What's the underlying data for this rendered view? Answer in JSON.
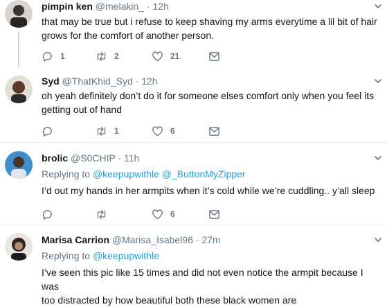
{
  "tweets": [
    {
      "name": "pimpin ken",
      "handle": "@melakin_",
      "dot": "·",
      "time": "12h",
      "lines": [
        "that may be true but i refuse to keep shaving my arms everytime a lil bit of hair",
        "grows for the comfort of another person."
      ],
      "replies": "1",
      "retweets": "2",
      "likes": "21"
    },
    {
      "name": "Syd",
      "handle": "@ThatKhid_Syd",
      "dot": "·",
      "time": "12h",
      "lines": [
        "oh yeah definitely don’t do it for someone elses comfort only when you feel its",
        "getting out of hand"
      ],
      "replies": "",
      "retweets": "1",
      "likes": "6"
    },
    {
      "name": "brolic",
      "handle": "@S0CHIP",
      "dot": "·",
      "time": "11h",
      "replying_to_label": "Replying to",
      "mention_1": "@keepupwithle",
      "mention_2": "@_ButtonMyZipper",
      "lines": [
        "I’d out my hands in her armpits when it’s cold while we’re cuddling.. y’all sleep"
      ],
      "replies": "",
      "retweets": "",
      "likes": "6"
    },
    {
      "name": "Marisa Carrion",
      "handle": "@Marisa_Isabel96",
      "dot": "·",
      "time": "27m",
      "replying_to_label": "Replying to",
      "mention_1": "@keepupwithle",
      "lines": [
        "I’ve seen this pic like 15 times and did not even notice the armpit because I was",
        "too distracted by how beautiful both these black women are"
      ]
    }
  ],
  "icons": {
    "reply": "reply-icon",
    "retweet": "retweet-icon",
    "like": "heart-icon",
    "dm": "envelope-icon",
    "more": "chevron-down-icon"
  },
  "colors": {
    "accent": "#1da1f2",
    "secondary_text": "#657786",
    "divider": "#e6ecf0"
  }
}
